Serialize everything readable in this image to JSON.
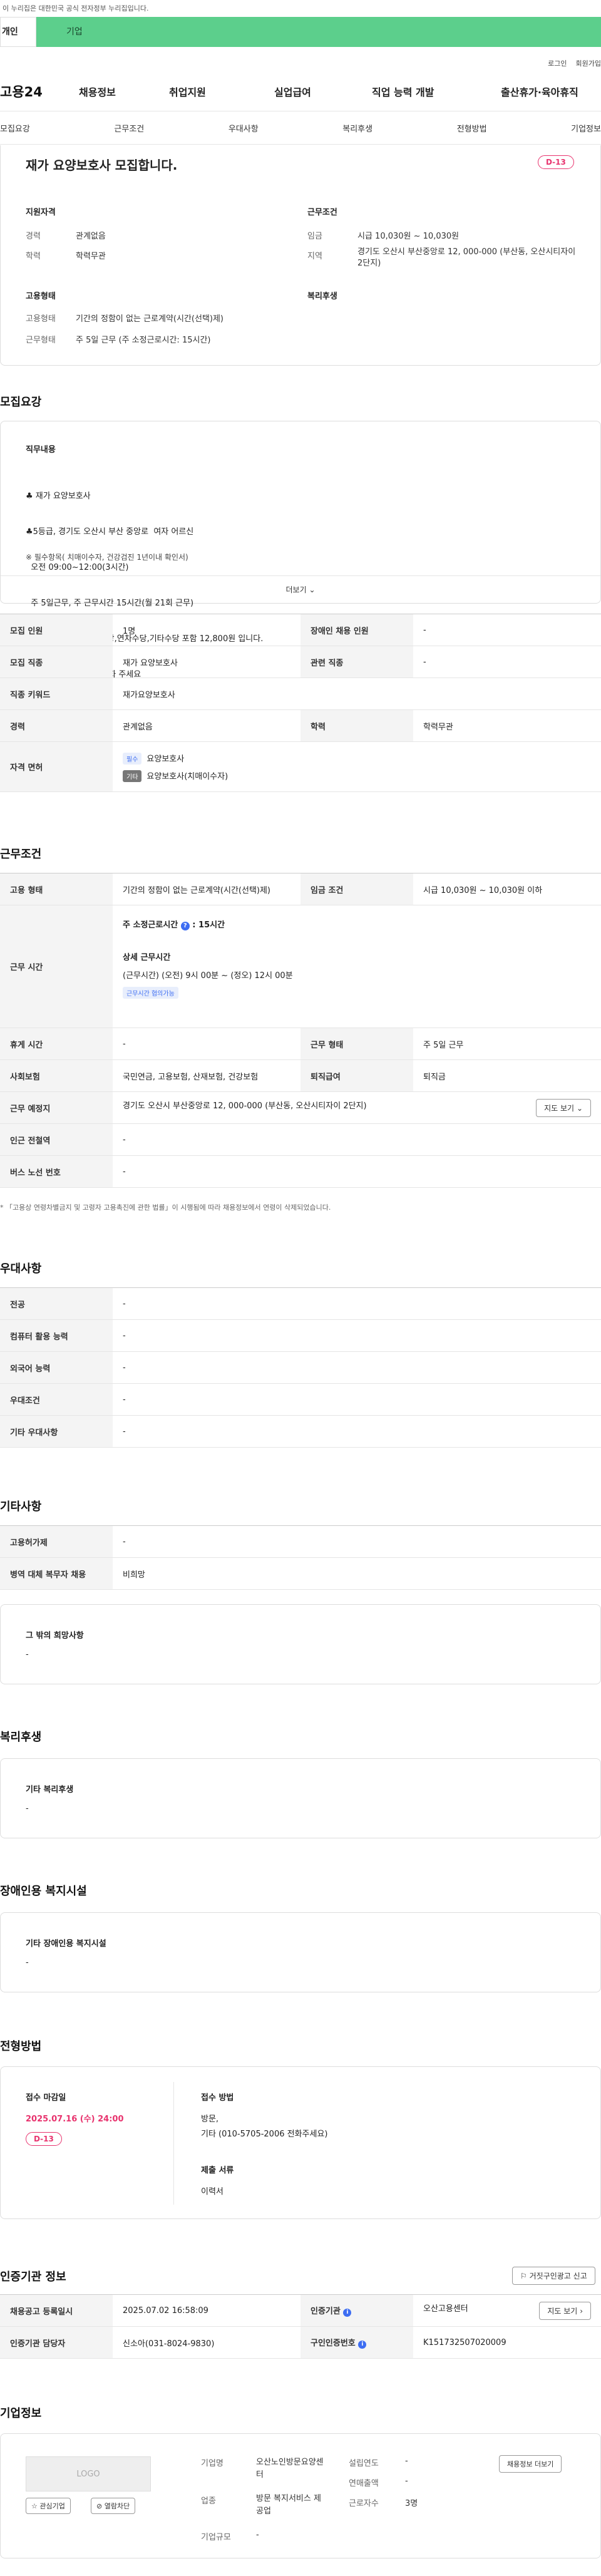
{
  "gov_notice": "이 누리집은 대한민국 공식 전자정부 누리집입니다.",
  "user_tabs": [
    "개인",
    "기업"
  ],
  "util_links": [
    "로그인",
    "회원가입"
  ],
  "logo": "고용24",
  "gnb": [
    "채용정보",
    "취업지원",
    "실업급여",
    "직업 능력 개발",
    "출산휴가·육아휴직"
  ],
  "snb": [
    "모집요강",
    "근무조건",
    "우대사항",
    "복리후생",
    "전형방법",
    "기업정보"
  ],
  "summary": {
    "title": "재가 요양보호사 모집합니다.",
    "dday": "D-13",
    "qual_heading": "지원자격",
    "career_label": "경력",
    "career": "관계없음",
    "edu_label": "학력",
    "edu": "학력무관",
    "cond_heading": "근무조건",
    "wage_label": "임금",
    "wage": "시급 10,030원 ~ 10,030원",
    "region_label": "지역",
    "region": "경기도 오산시 부산중앙로 12, 000-000 (부산동, 오산시티자이 2단지)",
    "emp_heading": "고용형태",
    "type_label": "고용형태",
    "type": "기간의 정함이 없는 근로계약(시간(선택)제)",
    "form_label": "근무형태",
    "form": "주 5일 근무 (주 소정근로시간: 15시간)",
    "welfare_heading": "복리후생"
  },
  "recruit": {
    "heading": "모집요강",
    "job_heading": "직무내용",
    "job_lines": [
      "♣ 재가 요양보호사",
      "♣5등급, 경기도 오산시 부산 중앙로  여자 어르신",
      "  오전 09:00~12:00(3시간)",
      "  주 5일근무, 주 근무시간 15시간(월 21회 근무)",
      "  시급10,030원 주휴수당,연차수당,기타수당 포함 12,800원 입니다.",
      "♣ 010-5705-2006 전화 주세요"
    ],
    "note": "필수항목( 치매이수자, 건강검진 1년이내 확인서)",
    "more": "더보기",
    "rows": [
      {
        "k1": "모집 인원",
        "v1": "1명",
        "k2": "장애인 채용 인원",
        "v2": "-"
      },
      {
        "k1": "모집 직종",
        "v1": "재가 요양보호사",
        "k2": "관련 직종",
        "v2": "-"
      },
      {
        "k1": "직종 키워드",
        "v1": "재가요양보호사",
        "k2": "",
        "v2": ""
      },
      {
        "k1": "경력",
        "v1": "관계없음",
        "k2": "학력",
        "v2": "학력무관"
      }
    ],
    "license_label": "자격 면허",
    "license_req_chip": "필수",
    "license_req": "요양보호사",
    "license_pref_chip": "기타",
    "license_pref": "요양보호사(치매이수자)"
  },
  "conditions": {
    "heading": "근무조건",
    "type_label": "고용 형태",
    "type": "기간의 정함이 없는 근로계약(시간(선택)제)",
    "wage_label": "임금 조건",
    "wage": "시급 10,030원 ~ 10,030원 이하",
    "hours_label": "근무 시간",
    "weekly": "주 소정근로시간",
    "weekly_val": "15시간",
    "detail_heading": "상세 근무시간",
    "detail": "(근무시간) (오전) 9시 00분 ~ (정오) 12시 00분",
    "detail_chip": "근무시간 협의가능",
    "rest_label": "휴게 시간",
    "rest": "-",
    "form_label": "근무 형태",
    "form": "주 5일 근무",
    "insurance_label": "사회보험",
    "insurance": "국민연금, 고용보험, 산재보험, 건강보험",
    "severance_label": "퇴직급여",
    "severance": "퇴직금",
    "place_label": "근무 예정지",
    "place": "경기도 오산시 부산중앙로 12, 000-000 (부산동, 오산시티자이 2단지)",
    "map_btn": "지도 보기",
    "station_label": "인근 전철역",
    "station": "-",
    "bus_label": "버스 노선 번호",
    "bus": "-",
    "footnote": "「고용상 연령차별금지 및 고령자 고용촉진에 관한 법률」이 시행됨에 따라 채용정보에서 연령이 삭제되었습니다."
  },
  "preference": {
    "heading": "우대사항",
    "rows": [
      {
        "k": "전공",
        "v": "-"
      },
      {
        "k": "컴퓨터 활용 능력",
        "v": "-"
      },
      {
        "k": "외국어 능력",
        "v": "-"
      },
      {
        "k": "우대조건",
        "v": "-"
      },
      {
        "k": "기타 우대사항",
        "v": "-"
      }
    ]
  },
  "other": {
    "heading": "기타사항",
    "rows": [
      {
        "k": "고용허가제",
        "v": "-"
      },
      {
        "k": "병역 대체 복무자 채용",
        "v": "비희망"
      }
    ],
    "box_title": "그 밖의 희망사항",
    "box_val": "-"
  },
  "welfare": {
    "heading": "복리후생",
    "box_title": "기타 복리후생",
    "box_val": "-"
  },
  "disability": {
    "heading": "장애인용 복지시설",
    "box_title": "기타 장애인용 복지시설",
    "box_val": "-"
  },
  "selection": {
    "heading": "전형방법",
    "deadline_label": "접수 마감일",
    "deadline": "2025.07.16 (수) 24:00",
    "dday": "D-13",
    "method_label": "접수 방법",
    "method1": "방문,",
    "method2": "기타 (010-5705-2006 전화주세요)",
    "docs_label": "제출 서류",
    "docs": "이력서"
  },
  "cert": {
    "heading": "인증기관 정보",
    "copy_btn": "거짓구인광고 신고",
    "rows": [
      {
        "k1": "채용공고 등록일시",
        "v1": "2025.07.02 16:58:09",
        "k2": "인증기관",
        "v2": "오산고용센터",
        "btn": "지도 보기"
      },
      {
        "k1": "인증기관 담당자",
        "v1": "신소아(031-8024-9830)",
        "k2": "구인인증번호",
        "v2": "K151732507020009",
        "btn": ""
      }
    ]
  },
  "company": {
    "heading": "기업정보",
    "logo_text": "LOGO",
    "fav_btn": "관심기업",
    "block_btn": "열람차단",
    "name_label": "기업명",
    "name": "오산노인방문요양센터",
    "industry_label": "업종",
    "industry": "방문 복지서비스 제공업",
    "size_label": "기업규모",
    "size": "-",
    "founded_label": "설립연도",
    "founded": "-",
    "sales_label": "연매출액",
    "sales": "-",
    "employees_label": "근로자수",
    "employees": "3명",
    "jobs_btn": "채용정보 더보기"
  },
  "colors": {
    "accent_green": "#5ccf8c",
    "dday_pink": "#e8336e",
    "info_blue": "#3d6df2"
  }
}
